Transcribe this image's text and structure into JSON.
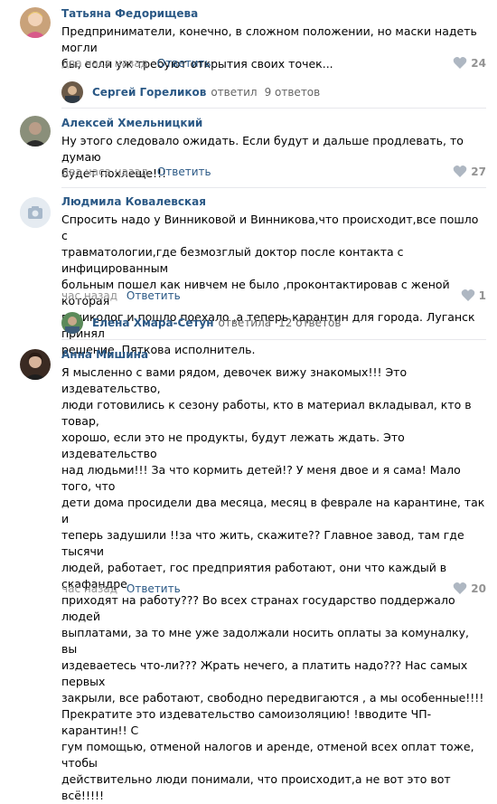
{
  "colors": {
    "link": "#2a5885",
    "meta": "#939393",
    "divider": "#e7e8ec"
  },
  "comments": [
    {
      "author": "Татьяна Федорищева",
      "text": "Предприниматели, конечно, в сложном положении, но маски надеть могли\nбы, если уж требуют открытия своих точек...",
      "time": "два часа назад",
      "reply": "Ответить",
      "likes": "24"
    },
    {
      "author": "Алексей Хмельницкий",
      "text": "Ну этого следовало ожидать. Если будут и дальше продлевать, то думаю\nбудет похлеще!!!",
      "time": "два часа назад",
      "reply": "Ответить",
      "likes": "27"
    },
    {
      "author": "Людмила Ковалевская",
      "text": "Спросить надо у Винниковой и Винникова,что происходит,все пошло с\nтравматологии,где безмозглый доктор после контакта с инфицированным\nбольным пошел как нивчем не было ,проконтактировав с женой которая\nгиниколог и пошло поехало ,а теперь карантин для города. Луганск принял\nрешение. Пяткова исполнитель.",
      "time": "час назад",
      "reply": "Ответить",
      "likes": "1"
    },
    {
      "author": "Анна Мишина",
      "text": "Я мысленно с вами рядом, девочек вижу знакомых!!! Это издевательство,\nлюди готовились к сезону работы, кто в материал вкладывал, кто в товар,\nхорошо, если это не продукты, будут лежать ждать. Это издевательство\nнад людьми!!! За что кормить детей!? У меня двое и я сама! Мало того, что\nдети дома просидели два месяца, месяц в феврале на карантине, так и\nтеперь задушили !!за что жить, скажите?? Главное завод, там где тысячи\nлюдей, работает, гос предприятия работают, они что каждый в скафандре\nприходят на работу??? Во всех странах государство поддержало людей\nвыплатами, за то мне уже задолжали носить оплаты за комуналку, вы\nиздеваетесь что-ли??? Жрать нечего, а платить надо??? Нас самых первых\nзакрыли, все работают, свободно передвигаются , а мы особенные!!!!\nПрекратите это издевательство самоизоляцию! !вводите ЧП-карантин!! С\nгум помощью, отменой налогов и аренде, отменой всех оплат тоже, чтобы\nдействительно люди понимали, что происходит,а не вот это вот всё!!!!!",
      "time": "час назад",
      "reply": "Ответить",
      "likes": "20"
    }
  ],
  "threads": [
    {
      "name": "Сергей Гореликов",
      "verb": "ответил",
      "count": "9 ответов"
    },
    {
      "name": "Елена Хмара-Сетун",
      "verb": "ответила",
      "count": "12 ответов"
    }
  ]
}
